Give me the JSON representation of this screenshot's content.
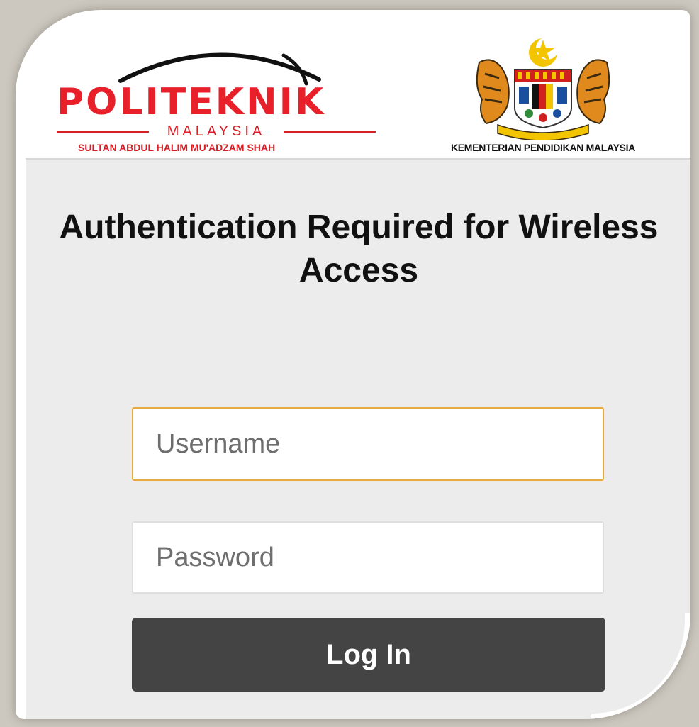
{
  "header": {
    "institution_logo": {
      "wordmark": "POLITEKNIK",
      "country": "MALAYSIA",
      "subtitle": "SULTAN ABDUL HALIM MU'ADZAM SHAH",
      "brand_color": "#e8202a"
    },
    "ministry_logo": {
      "icon": "coat-of-arms-icon",
      "label": "KEMENTERIAN PENDIDIKAN MALAYSIA"
    }
  },
  "main": {
    "title": "Authentication Required for Wireless Access"
  },
  "form": {
    "username": {
      "value": "",
      "placeholder": "Username",
      "focus_color": "#e6aa3e"
    },
    "password": {
      "value": "",
      "placeholder": "Password"
    },
    "login_label": "Log In",
    "login_color": "#444444"
  }
}
